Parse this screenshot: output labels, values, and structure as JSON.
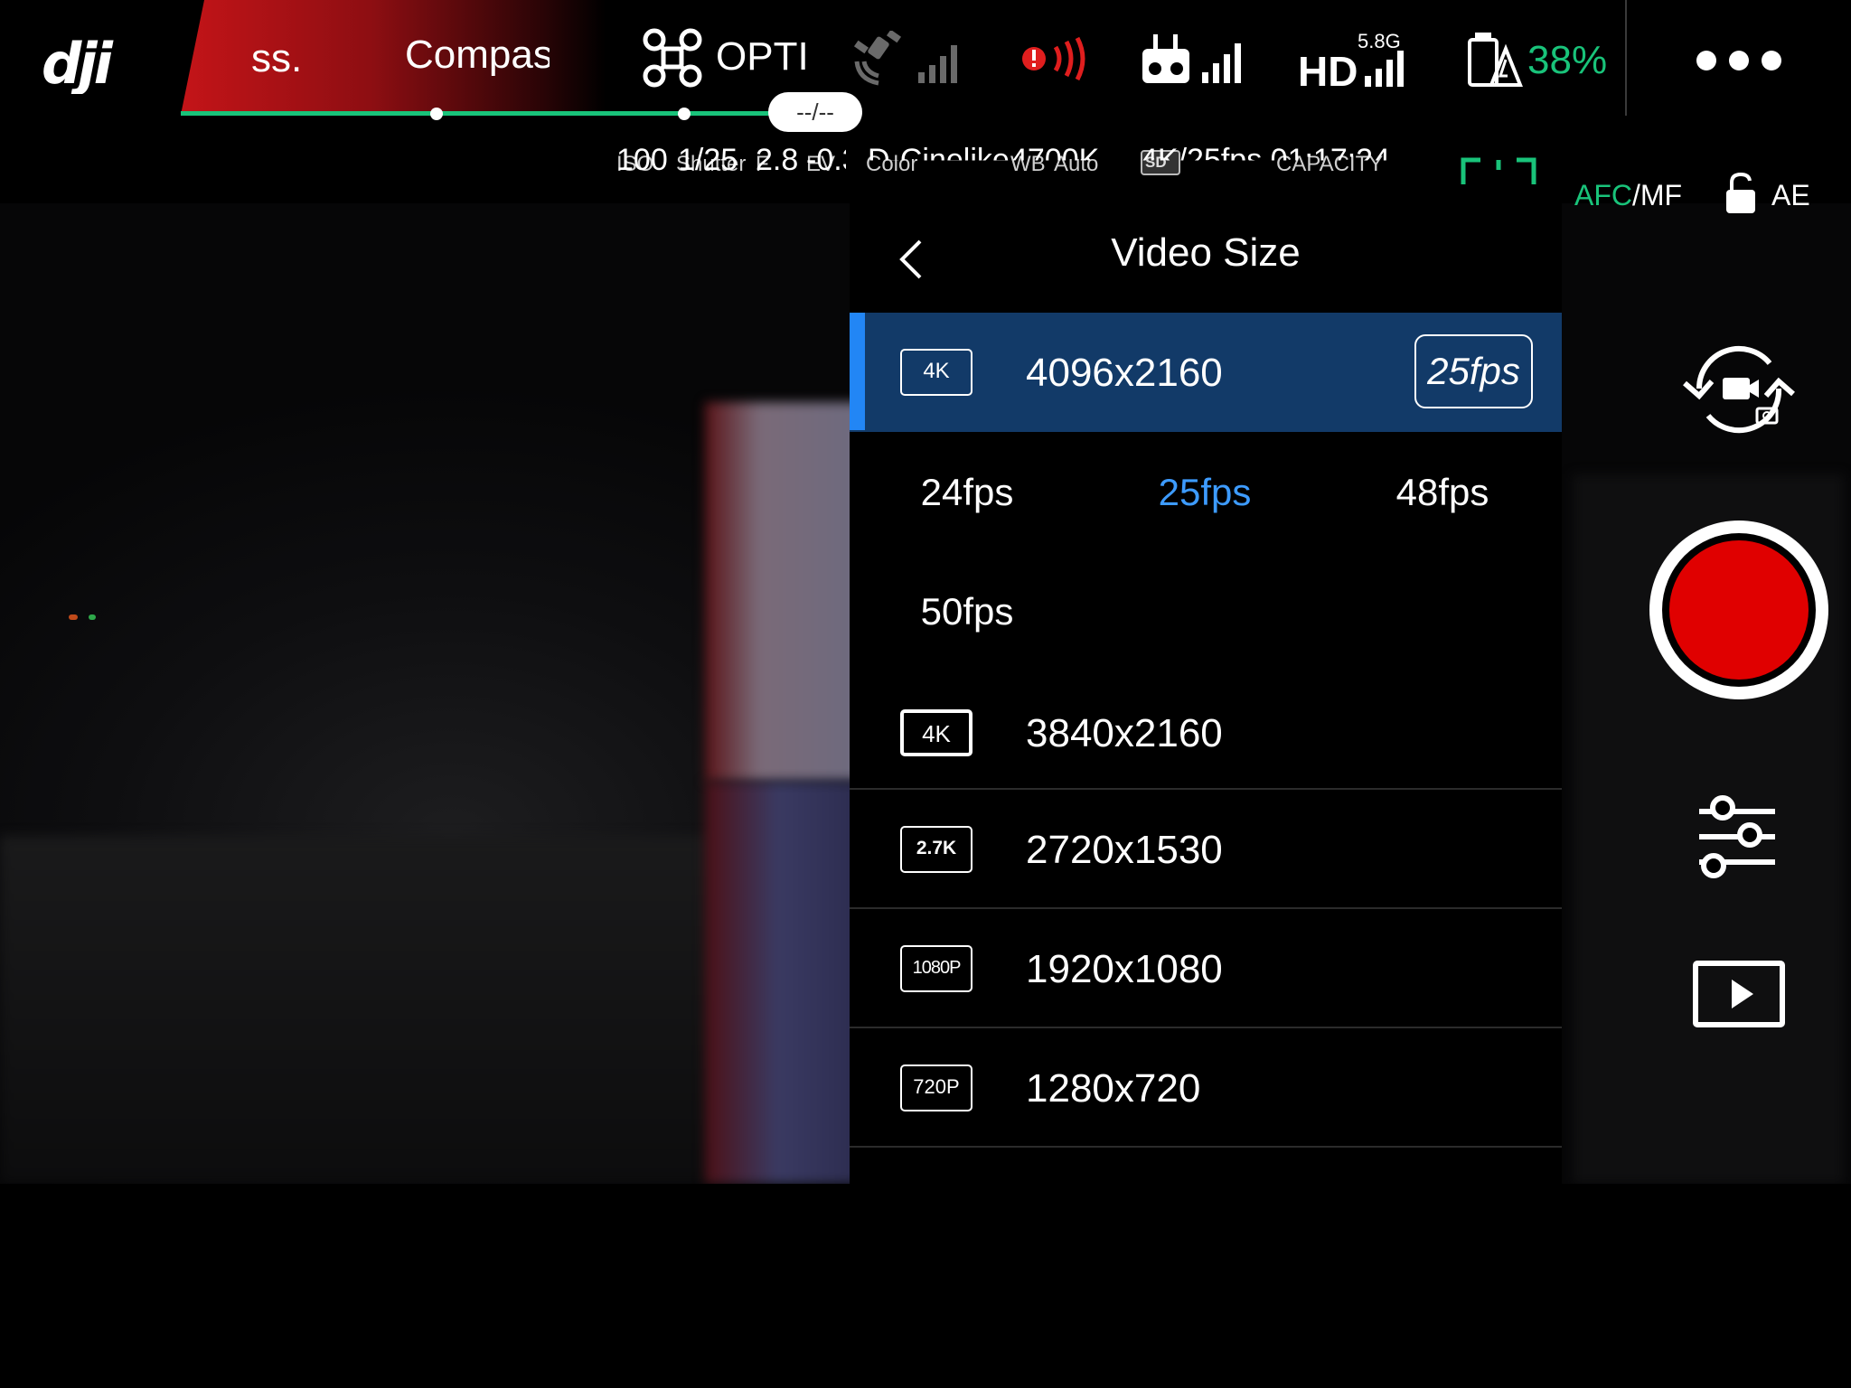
{
  "topbar": {
    "flight_mode_short": "ss.",
    "compass_label": "Compass",
    "flight_status": "OPTI",
    "time_pill": "--/--",
    "link_band": "5.8G",
    "hd_label": "HD",
    "battery_percent": "38%",
    "more_label": "•••"
  },
  "params": {
    "iso_label": "ISO",
    "iso_value": "100",
    "shutter_label": "Shutter",
    "shutter_value": "1/25",
    "f_label": "F",
    "f_value": "2.8",
    "ev_label": "EV",
    "ev_value": "-0.3",
    "color_label": "Color",
    "color_value": "D-Cinelike",
    "wb_label": "WB",
    "wb_mode": "Auto",
    "wb_value": "4700K",
    "sd_label": "SD",
    "capacity_label": "CAPACITY",
    "capacity_value": "4K/25fps 01:17:24",
    "afc_label": "AFC",
    "mf_label": "/MF",
    "ae_label": "AE"
  },
  "panel": {
    "title": "Video Size",
    "selected": {
      "badge": "4K",
      "resolution": "4096x2160",
      "fps": "25fps"
    },
    "fps_options": [
      "24fps",
      "25fps",
      "48fps",
      "50fps"
    ],
    "active_fps": "25fps",
    "sizes": [
      {
        "badge": "4K",
        "resolution": "3840x2160"
      },
      {
        "badge": "2.7K",
        "resolution": "2720x1530"
      },
      {
        "badge": "1080P",
        "resolution": "1920x1080"
      },
      {
        "badge": "720P",
        "resolution": "1280x720"
      }
    ]
  },
  "colors": {
    "accent_green": "#19c37a",
    "selected_row": "#123a68",
    "selected_bar": "#2286f5",
    "active_fps": "#3d9bff",
    "record_red": "#e00000",
    "warning_red": "#e01e1e"
  }
}
